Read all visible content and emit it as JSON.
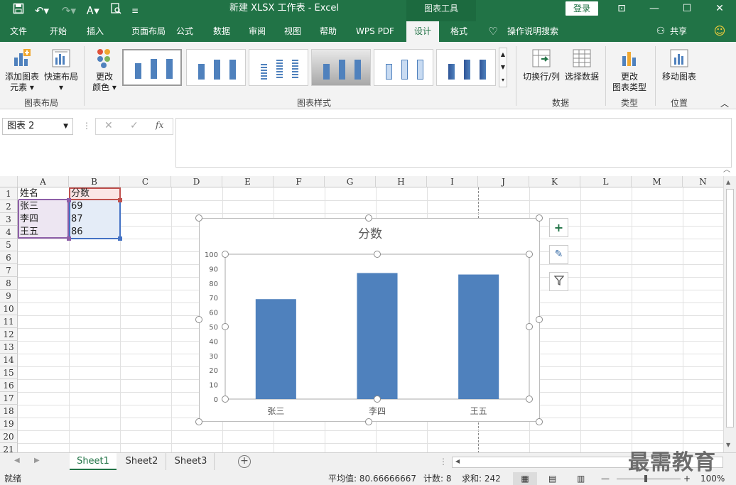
{
  "titlebar": {
    "title": "新建 XLSX 工作表  -  Excel",
    "context_tool": "图表工具",
    "login": "登录"
  },
  "tabs": [
    "文件",
    "开始",
    "插入",
    "页面布局",
    "公式",
    "数据",
    "审阅",
    "视图",
    "帮助",
    "WPS PDF",
    "设计",
    "格式"
  ],
  "tellme": "操作说明搜索",
  "share": "共享",
  "ribbon": {
    "add_element": [
      "添加图表",
      "元素"
    ],
    "quick_layout": "快速布局",
    "change_colors": [
      "更改",
      "颜色"
    ],
    "group_layout": "图表布局",
    "group_styles": "图表样式",
    "switch_rowcol": "切换行/列",
    "select_data": "选择数据",
    "group_data": "数据",
    "change_type": [
      "更改",
      "图表类型"
    ],
    "group_type": "类型",
    "move_chart": "移动图表",
    "group_location": "位置"
  },
  "formula": {
    "namebox": "图表 2"
  },
  "columns": [
    "A",
    "B",
    "C",
    "D",
    "E",
    "F",
    "G",
    "H",
    "I",
    "J",
    "K",
    "L",
    "M",
    "N"
  ],
  "rows": [
    "1",
    "2",
    "3",
    "4",
    "5",
    "6",
    "7",
    "8",
    "9",
    "10",
    "11",
    "12",
    "13",
    "14",
    "15",
    "16",
    "17",
    "18",
    "19",
    "20",
    "21"
  ],
  "cells": {
    "A1": "姓名",
    "B1": "分数",
    "A2": "张三",
    "B2": "69",
    "A3": "李四",
    "B3": "87",
    "A4": "王五",
    "B4": "86"
  },
  "sheets": [
    "Sheet1",
    "Sheet2",
    "Sheet3"
  ],
  "status": {
    "mode": "就绪",
    "average": "平均值: 80.66666667",
    "count": "计数: 8",
    "sum": "求和: 242",
    "zoom": "100%"
  },
  "watermark": "最需教育",
  "colors": {
    "excel_green": "#217346",
    "bar": "#4f81bd"
  },
  "chart_data": {
    "type": "bar",
    "title": "分数",
    "categories": [
      "张三",
      "李四",
      "王五"
    ],
    "values": [
      69,
      87,
      86
    ],
    "ylim": [
      0,
      100
    ],
    "yticks": [
      0,
      10,
      20,
      30,
      40,
      50,
      60,
      70,
      80,
      90,
      100
    ],
    "grid": false,
    "legend": "none"
  }
}
